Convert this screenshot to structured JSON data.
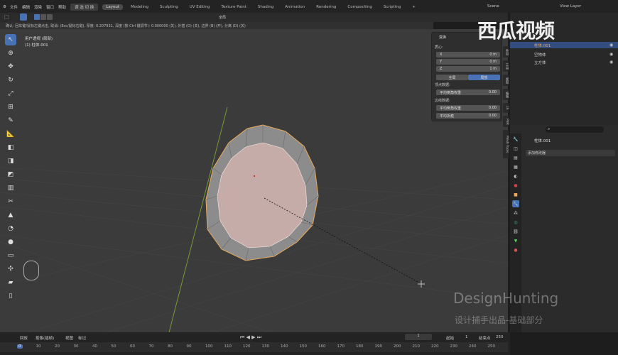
{
  "menu": {
    "items": [
      "文件",
      "编辑",
      "渲染",
      "窗口",
      "帮助"
    ],
    "mode": "调 选 切 换"
  },
  "workspaces": [
    "Layout",
    "Modeling",
    "Sculpting",
    "UV Editing",
    "Texture Paint",
    "Shading",
    "Animation",
    "Rendering",
    "Compositing",
    "Scripting",
    "+"
  ],
  "scene": "Scene",
  "view_layer": "View Layer",
  "header2": {
    "orientation": "全局"
  },
  "status_hint": "确认: 回车键/鼠标左键点击, 取消: (Esc/鼠标右键), 厚度: 0.207931, 深度 (按 Ctrl 键调节): 0.000000 (关), 外插 (O) (关), 边界 (B) (开), 分离 (D) (关)",
  "viewport": {
    "view_name": "用户透视 (局部)",
    "object": "(1) 柱体.001"
  },
  "panel": {
    "title": "变换",
    "median_label": "质心:",
    "x_label": "X",
    "x_val": "0 m",
    "y_label": "Y",
    "y_val": "0 m",
    "z_label": "Z",
    "z_val": "1 m",
    "btn_global": "全局",
    "btn_local": "局部",
    "vertex_label": "顶点数据:",
    "vertex_field": "平均倒角权重",
    "vertex_val": "0.00",
    "edge_label": "边线数据:",
    "edge_bevel": "平均倒角权重",
    "edge_bevel_val": "0.00",
    "edge_crease": "平均折痕",
    "edge_crease_val": "0.00"
  },
  "ntabs": [
    "条目",
    "工具",
    "视图",
    "编辑",
    "LS",
    "PBR",
    "Mesh Tools"
  ],
  "outliner": {
    "rows": [
      {
        "label": "柱体.001",
        "selected": true
      },
      {
        "label": "空物体",
        "selected": false
      },
      {
        "label": "立方体",
        "selected": false
      }
    ]
  },
  "props": {
    "object_name": "柱体.001",
    "add_modifier": "添加修改器"
  },
  "timeline": {
    "playback": "回放",
    "keying": "抠像(插帧)",
    "view": "视图",
    "marker": "标记",
    "current_frame": "1",
    "start_label": "起始",
    "start": "1",
    "end_label": "结束点",
    "end": "250"
  },
  "ruler": [
    "0",
    "10",
    "20",
    "30",
    "40",
    "50",
    "60",
    "70",
    "80",
    "90",
    "100",
    "110",
    "120",
    "130",
    "140",
    "150",
    "160",
    "170",
    "180",
    "190",
    "200",
    "210",
    "220",
    "230",
    "240",
    "250"
  ],
  "watermark": "西瓜视频",
  "brand": "DesignHunting",
  "brand_sub": "设计捕手出品-基础部分",
  "colors": {
    "accent": "#4872b5",
    "selection": "#e8a95c",
    "face": "#c6aca8"
  }
}
